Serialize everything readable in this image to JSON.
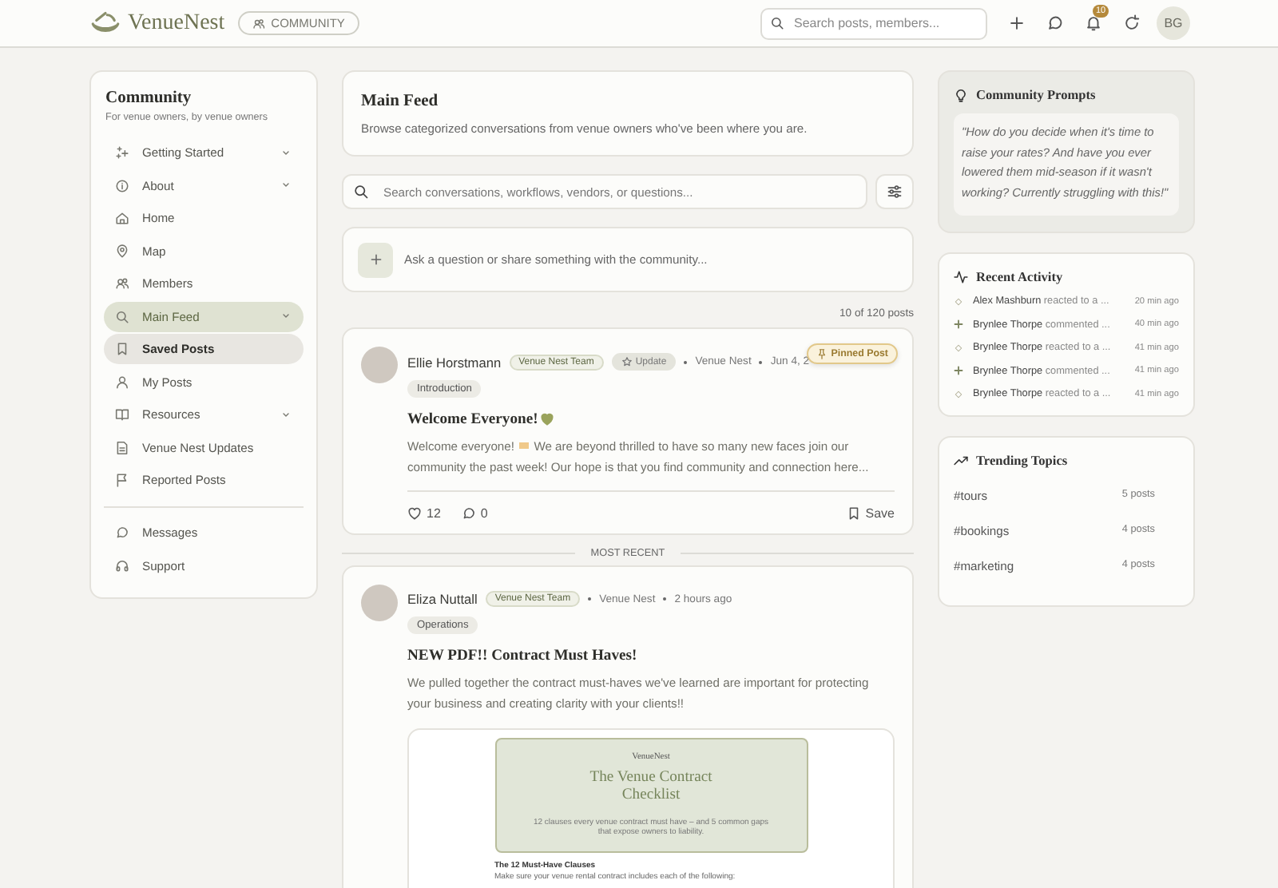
{
  "header": {
    "brand": "VenueNest",
    "chip": "COMMUNITY",
    "search": {
      "placeholder": "Search posts, members..."
    },
    "notifications": "10",
    "avatar": "BG"
  },
  "sidebar": {
    "title": "Community",
    "subtitle": "For venue owners, by venue owners",
    "items": [
      {
        "label": "Getting Started",
        "expandable": true,
        "selected": false,
        "hovered": false
      },
      {
        "label": "About",
        "expandable": true,
        "selected": false,
        "hovered": false
      },
      {
        "label": "Home",
        "expandable": false,
        "selected": false,
        "hovered": false
      },
      {
        "label": "Map",
        "expandable": false,
        "selected": false,
        "hovered": false
      },
      {
        "label": "Members",
        "expandable": false,
        "selected": false,
        "hovered": false
      },
      {
        "label": "Main Feed",
        "expandable": true,
        "selected": true,
        "hovered": false
      },
      {
        "label": "Saved Posts",
        "expandable": false,
        "selected": false,
        "hovered": true
      },
      {
        "label": "My Posts",
        "expandable": false,
        "selected": false,
        "hovered": false
      },
      {
        "label": "Resources",
        "expandable": true,
        "selected": false,
        "hovered": false
      },
      {
        "label": "Venue Nest Updates",
        "expandable": false,
        "selected": false,
        "hovered": false
      },
      {
        "label": "Reported Posts",
        "expandable": false,
        "selected": false,
        "hovered": false
      }
    ],
    "footer_items": [
      {
        "label": "Messages"
      },
      {
        "label": "Support"
      }
    ]
  },
  "feed": {
    "title": "Main Feed",
    "subtitle": "Browse categorized conversations from venue owners who've been where you are.",
    "search": {
      "placeholder": "Search conversations, workflows, vendors, or questions..."
    },
    "compose": {
      "placeholder": "Ask a question or share something with the community..."
    },
    "count": "10 of 120 posts",
    "divider": "MOST RECENT",
    "posts": [
      {
        "author": "Ellie Horstmann",
        "badges": [
          {
            "label": "Venue Nest Team",
            "kind": "team"
          },
          {
            "label": "Update",
            "kind": "update"
          }
        ],
        "source": "Venue Nest",
        "time": "Jun 4, 2",
        "pin_badge": "Pinned Post",
        "category": "Introduction",
        "title": "Welcome Everyone!",
        "title_icon": true,
        "body_lead": "Welcome everyone!",
        "body": "We are beyond thrilled to have so many new faces join our community the past week! Our hope is that you find community and connection here...",
        "likes": "12",
        "comments": "0",
        "save": "Save"
      },
      {
        "author": "Eliza Nuttall",
        "badges": [
          {
            "label": "Venue Nest Team",
            "kind": "team"
          }
        ],
        "source": "Venue Nest",
        "time": "2 hours ago",
        "category": "Operations",
        "title": "NEW PDF!! Contract Must Haves!",
        "title_icon": false,
        "body": "We pulled together the contract must-haves we've learned are important for protecting your business and creating clarity with your clients!!",
        "document": {
          "brand": "VenueNest",
          "title": "The Venue Contract Checklist",
          "subtitle": "12 clauses every venue contract must have – and 5 common gaps that expose owners to liability.",
          "section": "The 12 Must-Have Clauses",
          "note": "Make sure your venue rental contract includes each of the following:"
        }
      }
    ]
  },
  "aside": {
    "prompts": {
      "title": "Community Prompts",
      "quote": "\"How do you decide when it's time to raise your rates? And have you ever lowered them mid-season if it wasn't working? Currently struggling with this!\""
    },
    "activity": {
      "title": "Recent Activity",
      "items": [
        {
          "kind": "reaction",
          "name": "Alex Mashburn",
          "action": "reacted to a ...",
          "time": "20 min ago"
        },
        {
          "kind": "comment",
          "name": "Brynlee Thorpe",
          "action": "commented ...",
          "time": "40 min ago"
        },
        {
          "kind": "reaction",
          "name": "Brynlee Thorpe",
          "action": "reacted to a ...",
          "time": "41 min ago"
        },
        {
          "kind": "comment",
          "name": "Brynlee Thorpe",
          "action": "commented ...",
          "time": "41 min ago"
        },
        {
          "kind": "reaction",
          "name": "Brynlee Thorpe",
          "action": "reacted to a ...",
          "time": "41 min ago"
        }
      ]
    },
    "trending": {
      "title": "Trending Topics",
      "items": [
        {
          "tag": "#tours",
          "count": "5 posts"
        },
        {
          "tag": "#bookings",
          "count": "4 posts"
        },
        {
          "tag": "#marketing",
          "count": "4 posts"
        }
      ]
    }
  }
}
